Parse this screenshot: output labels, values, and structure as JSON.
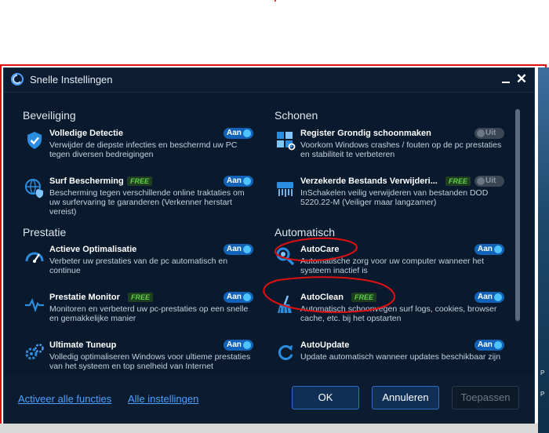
{
  "window": {
    "title": "Snelle Instellingen"
  },
  "columns": [
    {
      "sections": [
        {
          "title": "Beveiliging",
          "items": [
            {
              "name": "Volledige Detectie",
              "free": "",
              "toggle": "Aan",
              "state": "on",
              "icon": "shield-check-icon",
              "desc": "Verwijder de diepste infecties en beschermd uw PC tegen diversen bedreigingen"
            },
            {
              "name": "Surf Bescherming",
              "free": "FREE",
              "toggle": "Aan",
              "state": "on",
              "icon": "globe-shield-icon",
              "desc": "Bescherming tegen verschillende online traktaties om uw surfervaring te garanderen (Verkenner herstart vereist)"
            }
          ]
        },
        {
          "title": "Prestatie",
          "items": [
            {
              "name": "Actieve Optimalisatie",
              "free": "",
              "toggle": "Aan",
              "state": "on",
              "icon": "speedometer-icon",
              "desc": "Verbeter uw prestaties van de pc automatisch en continue"
            },
            {
              "name": "Prestatie Monitor",
              "free": "FREE",
              "toggle": "Aan",
              "state": "on",
              "icon": "pulse-icon",
              "desc": "Monitoren en verbeterd uw pc-prestaties op een snelle en gemakkelijke manier"
            },
            {
              "name": "Ultimate Tuneup",
              "free": "",
              "toggle": "Aan",
              "state": "on",
              "icon": "gears-icon",
              "desc": "Volledig optimaliseren Windows voor ultieme prestaties van het systeem en top snelheid van Internet"
            }
          ]
        }
      ]
    },
    {
      "sections": [
        {
          "title": "Schonen",
          "items": [
            {
              "name": "Register Grondig schoonmaken",
              "free": "",
              "toggle": "Uit",
              "state": "off",
              "icon": "registry-icon",
              "desc": "Voorkom Windows crashes / fouten op de pc prestaties en stabiliteit te verbeteren"
            },
            {
              "name": "Verzekerde Bestands Verwijderi...",
              "free": "FREE",
              "toggle": "Uit",
              "state": "off",
              "icon": "shredder-icon",
              "desc": "InSchakelen veilig verwijderen van bestanden DOD 5220.22-M (Veiliger maar langzamer)"
            }
          ]
        },
        {
          "title": "Automatisch",
          "items": [
            {
              "name": "AutoCare",
              "free": "",
              "toggle": "Aan",
              "state": "on",
              "icon": "magnifier-icon",
              "desc": "Automatische zorg voor uw computer wanneer het systeem inactief is"
            },
            {
              "name": "AutoClean",
              "free": "FREE",
              "toggle": "Aan",
              "state": "on",
              "icon": "broom-icon",
              "desc": "Automatisch schoonvegen surf logs, cookies, browser cache, etc. bij het opstarten"
            },
            {
              "name": "AutoUpdate",
              "free": "",
              "toggle": "Aan",
              "state": "on",
              "icon": "refresh-icon",
              "desc": "Update automatisch wanneer updates beschikbaar zijn"
            }
          ]
        }
      ]
    }
  ],
  "footer": {
    "activate_all": "Activeer alle functies",
    "all_settings": "Alle instellingen",
    "ok": "OK",
    "cancel": "Annuleren",
    "apply": "Toepassen"
  },
  "colors": {
    "background": "#0a1a2e",
    "accent": "#1263b8",
    "free_badge": "#5fd24a",
    "annotation": "#e01010"
  },
  "background_strip": {
    "chars": [
      "P",
      "P"
    ]
  }
}
